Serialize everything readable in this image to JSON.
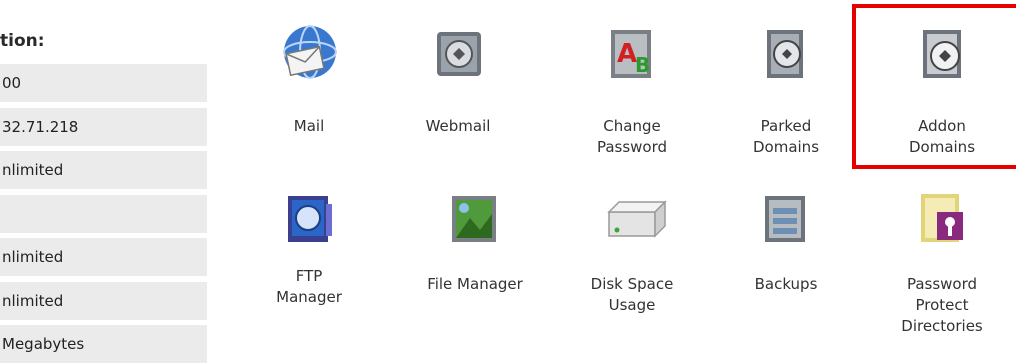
{
  "stats": {
    "heading": "tion:",
    "rows": [
      "00",
      "32.71.218",
      "nlimited",
      "",
      "nlimited",
      "nlimited",
      "Megabytes"
    ]
  },
  "tiles": [
    {
      "label": "Mail",
      "icon": "mail-globe-icon"
    },
    {
      "label": "Webmail",
      "icon": "webmail-icon"
    },
    {
      "label": "Change\nPassword",
      "icon": "change-password-icon"
    },
    {
      "label": "Parked\nDomains",
      "icon": "parked-domains-icon"
    },
    {
      "label": "Addon\nDomains",
      "icon": "addon-domains-icon"
    },
    {
      "label": "FTP\nManager",
      "icon": "ftp-manager-icon"
    },
    {
      "label": "File Manager",
      "icon": "file-manager-icon"
    },
    {
      "label": "Disk Space\nUsage",
      "icon": "disk-space-icon"
    },
    {
      "label": "Backups",
      "icon": "backups-icon"
    },
    {
      "label": "Password\nProtect\nDirectories",
      "icon": "password-protect-icon"
    }
  ],
  "colors": {
    "highlight": "#e60000",
    "row_background": "#ebebeb"
  }
}
